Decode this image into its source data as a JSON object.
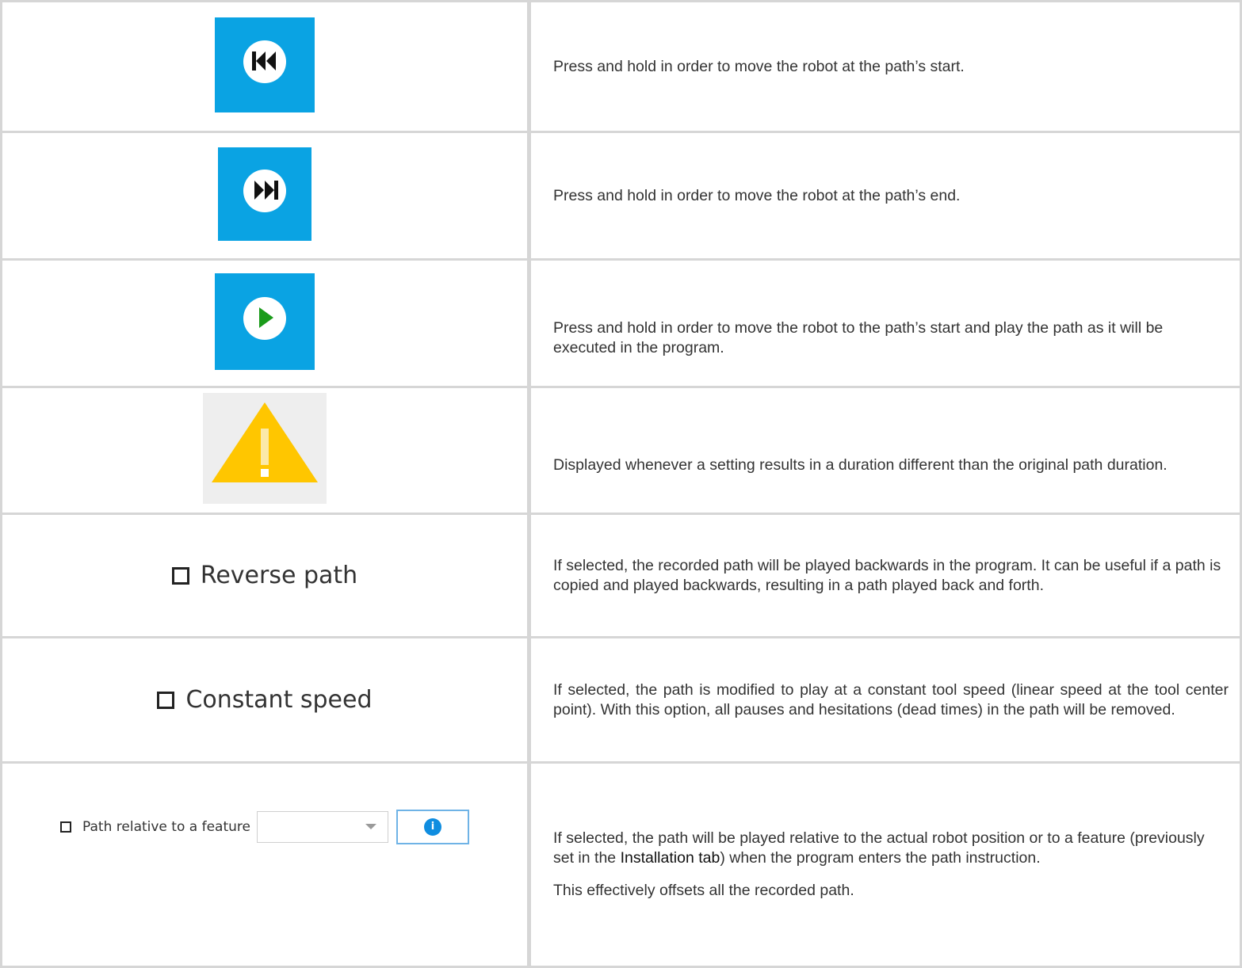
{
  "rows": [
    {
      "icon": "skip-back-icon",
      "description": "Press and hold in order to move the robot at the path’s start."
    },
    {
      "icon": "skip-forward-icon",
      "description": "Press and hold in order to move the robot at the path’s end."
    },
    {
      "icon": "play-icon",
      "description": "Press and hold in order to move the robot to the path’s start and play the path as it will be executed in the program."
    },
    {
      "icon": "warning-icon",
      "description": "Displayed whenever a setting results in a duration different than the original path duration."
    },
    {
      "control_label": "Reverse path",
      "description": "If selected, the recorded path will be played backwards in the program. It can be useful if a path is copied and played backwards, resulting in a path played back and forth."
    },
    {
      "control_label": "Constant speed",
      "description": "If selected, the path is modified to play at a constant tool speed (linear speed at the tool center point). With this option, all pauses and hesitations (dead times) in the path will be removed."
    },
    {
      "control_label": "Path relative to a feature",
      "select_value": "",
      "info_glyph": "i",
      "description_before": "If selected, the path will be played relative to the actual robot position or to a feature (previously set in the ",
      "description_emphasis": "Installation tab",
      "description_after": ") when the program enters the path instruction.",
      "description_2": "This effectively offsets all the recorded path."
    }
  ],
  "colors": {
    "button_blue": "#0aa3e3",
    "play_green": "#1a9b1a",
    "warning_yellow": "#ffc600",
    "border": "#d6d6d6"
  }
}
